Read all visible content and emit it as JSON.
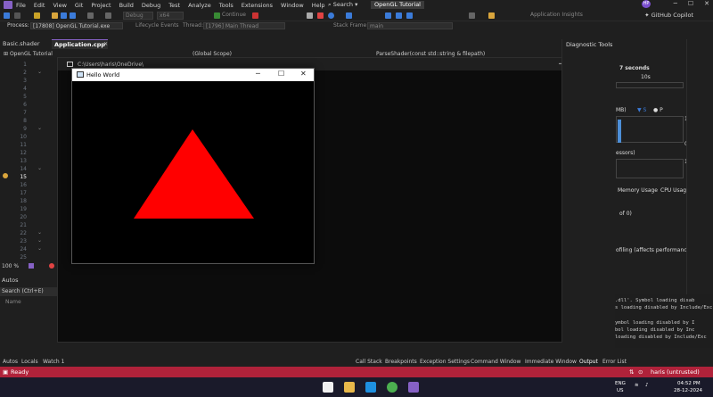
{
  "menu": {
    "items": [
      "File",
      "Edit",
      "View",
      "Git",
      "Project",
      "Build",
      "Debug",
      "Test",
      "Analyze",
      "Tools",
      "Extensions",
      "Window",
      "Help"
    ],
    "search": "Search",
    "title": "OpenGL Tutorial",
    "avatar": "HP"
  },
  "toolbar": {
    "config": "Debug",
    "platform": "x64",
    "continue": "Continue",
    "app_insights": "Application Insights",
    "copilot": "GitHub Copilot"
  },
  "processbar": {
    "process_label": "Process:",
    "process_value": "[17808] OpenGL Tutorial.exe",
    "lifecycle": "Lifecycle Events",
    "thread_label": "Thread:",
    "thread_value": "[1796] Main Thread",
    "stack_label": "Stack Frame:",
    "stack_value": "main"
  },
  "tabs": {
    "basic_shader": "Basic.shader",
    "application": "Application.cpp",
    "project": "OpenGL Tutorial",
    "scope": "(Global Scope)",
    "function": "ParseShader(const std::string & filepath)"
  },
  "editor": {
    "line_numbers": [
      "1",
      "2",
      "3",
      "4",
      "5",
      "6",
      "7",
      "8",
      "9",
      "10",
      "11",
      "12",
      "13",
      "14",
      "15",
      "16",
      "17",
      "18",
      "19",
      "20",
      "21",
      "22",
      "23",
      "24",
      "25"
    ],
    "zoom": "100 %",
    "autos_title": "Autos",
    "autos_search": "Search (Ctrl+E)",
    "autos_col": "Name"
  },
  "console": {
    "title": "C:\\Users\\haris\\OneDrive\\"
  },
  "hello": {
    "title": "Hello World",
    "triangle_color": "#ff0000"
  },
  "diagnostics": {
    "title": "Diagnostic Tools",
    "session": "7 seconds",
    "timeline": "10s",
    "mb": "MB)",
    "snapshot": "S",
    "private": "P",
    "mem_max": "145",
    "mem_min": "0",
    "proc": "essors)",
    "cpu_max": "100",
    "tab_memory": "Memory Usage",
    "tab_cpu": "CPU Usage",
    "events": "of 0)",
    "profiling": "ofiling (affects performance)"
  },
  "output": {
    "lines": [
      ".dll'. Symbol loading disab",
      "s loading disabled by Include/Exc",
      "ymbol loading disabled by I",
      "bol loading disabled by Inc",
      "loading disabled by Include/Exc"
    ]
  },
  "bottom_tabs": {
    "autos": "Autos",
    "locals": "Locals",
    "watch": "Watch 1",
    "call_stack": "Call Stack",
    "breakpoints": "Breakpoints",
    "exception": "Exception Settings",
    "command": "Command Window",
    "immediate": "Immediate Window",
    "output": "Output",
    "error": "Error List"
  },
  "status": {
    "ready": "Ready",
    "user": "haris (untrusted)"
  },
  "taskbar": {
    "lang": "ENG",
    "region": "US",
    "time": "04:52 PM",
    "date": "28-12-2024"
  },
  "colors": {
    "accent": "#8661c5",
    "status_bar": "#b0223a",
    "triangle": "#ff0000"
  }
}
